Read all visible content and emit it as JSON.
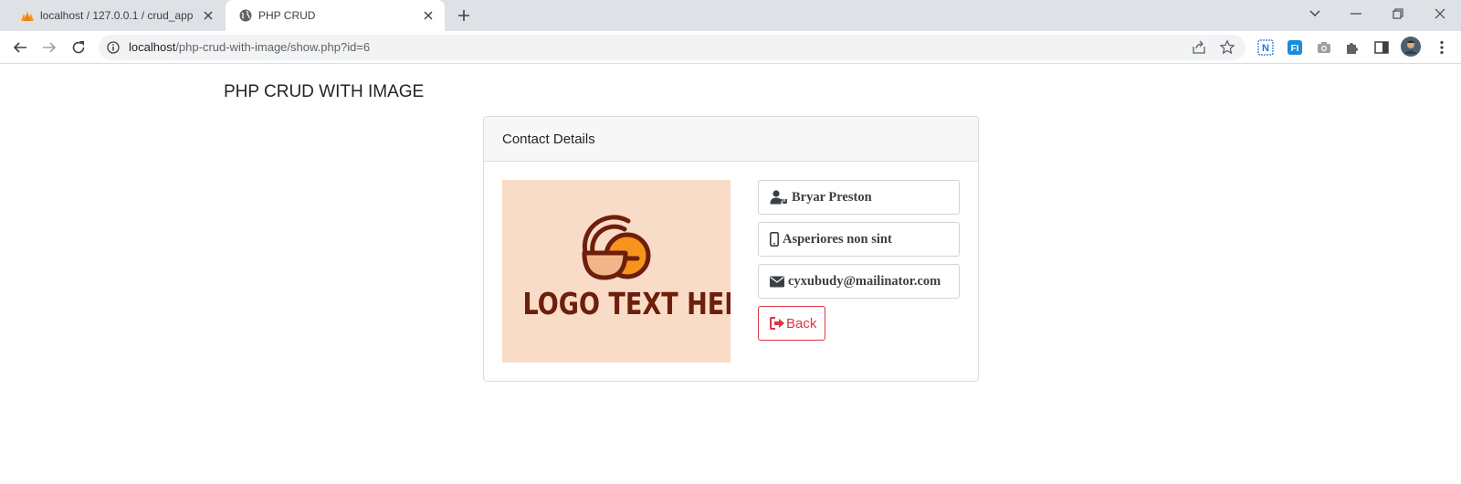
{
  "browser": {
    "tabs": [
      {
        "title": "localhost / 127.0.0.1 / crud_app | ",
        "favicon": "phpmyadmin-icon",
        "active": false
      },
      {
        "title": "PHP CRUD",
        "favicon": "globe-icon",
        "active": true
      }
    ],
    "address_bar": {
      "host": "localhost",
      "path": "/php-crud-with-image/show.php?id=6"
    }
  },
  "page": {
    "title": "PHP CRUD WITH IMAGE",
    "card": {
      "header": "Contact Details",
      "image": {
        "logo_text": "LOGO TEXT HERE",
        "background_color": "#f9dcc7"
      },
      "fields": {
        "name": "Bryar Preston",
        "phone": "Asperiores non sint",
        "email": "cyxubudy@mailinator.com"
      },
      "back_label": "Back"
    }
  },
  "colors": {
    "danger": "#dc3545",
    "field_text": "#3a3f44",
    "logo_orange": "#f7941d",
    "logo_brown": "#6e1f0c"
  }
}
